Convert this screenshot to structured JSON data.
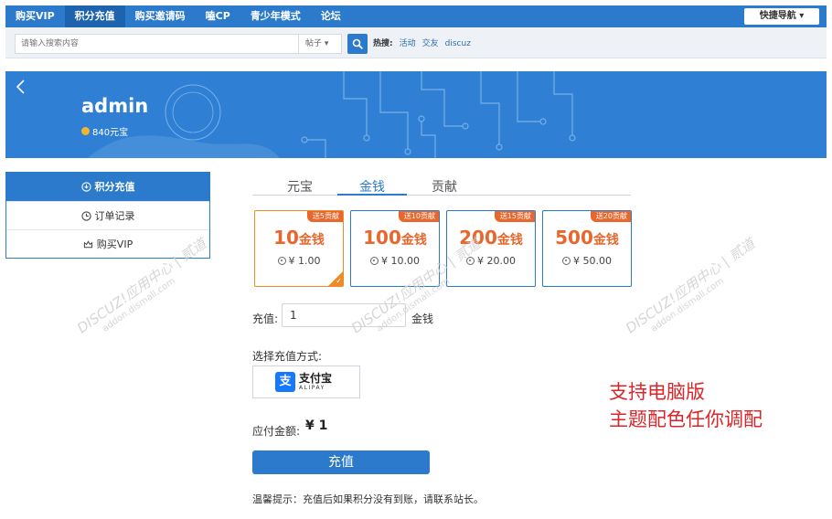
{
  "topnav": {
    "items": [
      "购买VIP",
      "积分充值",
      "购买邀请码",
      "嗑CP",
      "青少年模式",
      "论坛"
    ],
    "active_index": 1,
    "quick_nav": "快捷导航 ▾"
  },
  "search": {
    "placeholder": "请输入搜索内容",
    "scope": "帖子 ▾",
    "hot_label": "热搜:",
    "hot_links": [
      "活动",
      "交友",
      "discuz"
    ]
  },
  "banner": {
    "username": "admin",
    "coins": "840元宝"
  },
  "sidebar": {
    "items": [
      "积分充值",
      "订单记录",
      "购买VIP"
    ],
    "active_index": 0
  },
  "tabs": {
    "items": [
      "元宝",
      "金钱",
      "贡献"
    ],
    "active_index": 1
  },
  "packages": [
    {
      "badge": "送5贡献",
      "amount": "10",
      "unit": "金钱",
      "price": "¥ 1.00",
      "selected": true
    },
    {
      "badge": "送10贡献",
      "amount": "100",
      "unit": "金钱",
      "price": "¥ 10.00",
      "selected": false
    },
    {
      "badge": "送15贡献",
      "amount": "200",
      "unit": "金钱",
      "price": "¥ 20.00",
      "selected": false
    },
    {
      "badge": "送20贡献",
      "amount": "500",
      "unit": "金钱",
      "price": "¥ 50.00",
      "selected": false
    }
  ],
  "form": {
    "recharge_label": "充值:",
    "recharge_value": "1",
    "recharge_unit": "金钱",
    "method_label": "选择充值方式:",
    "alipay_cn": "支付宝",
    "alipay_en": "ALIPAY",
    "due_label": "应付金额:",
    "due_value": "¥ 1",
    "submit": "充值",
    "tip": "温馨提示：充值后如果积分没有到账，请联系站长。"
  },
  "promo": {
    "line1": "支持电脑版",
    "line2": "主题配色任你调配"
  },
  "watermark": {
    "main": "DISCUZ!应用中心 | 贰道",
    "sub": "addon.dismall.com"
  },
  "colors": {
    "primary": "#2b7acb",
    "accent": "#e8672c",
    "promo": "#d9262a"
  }
}
